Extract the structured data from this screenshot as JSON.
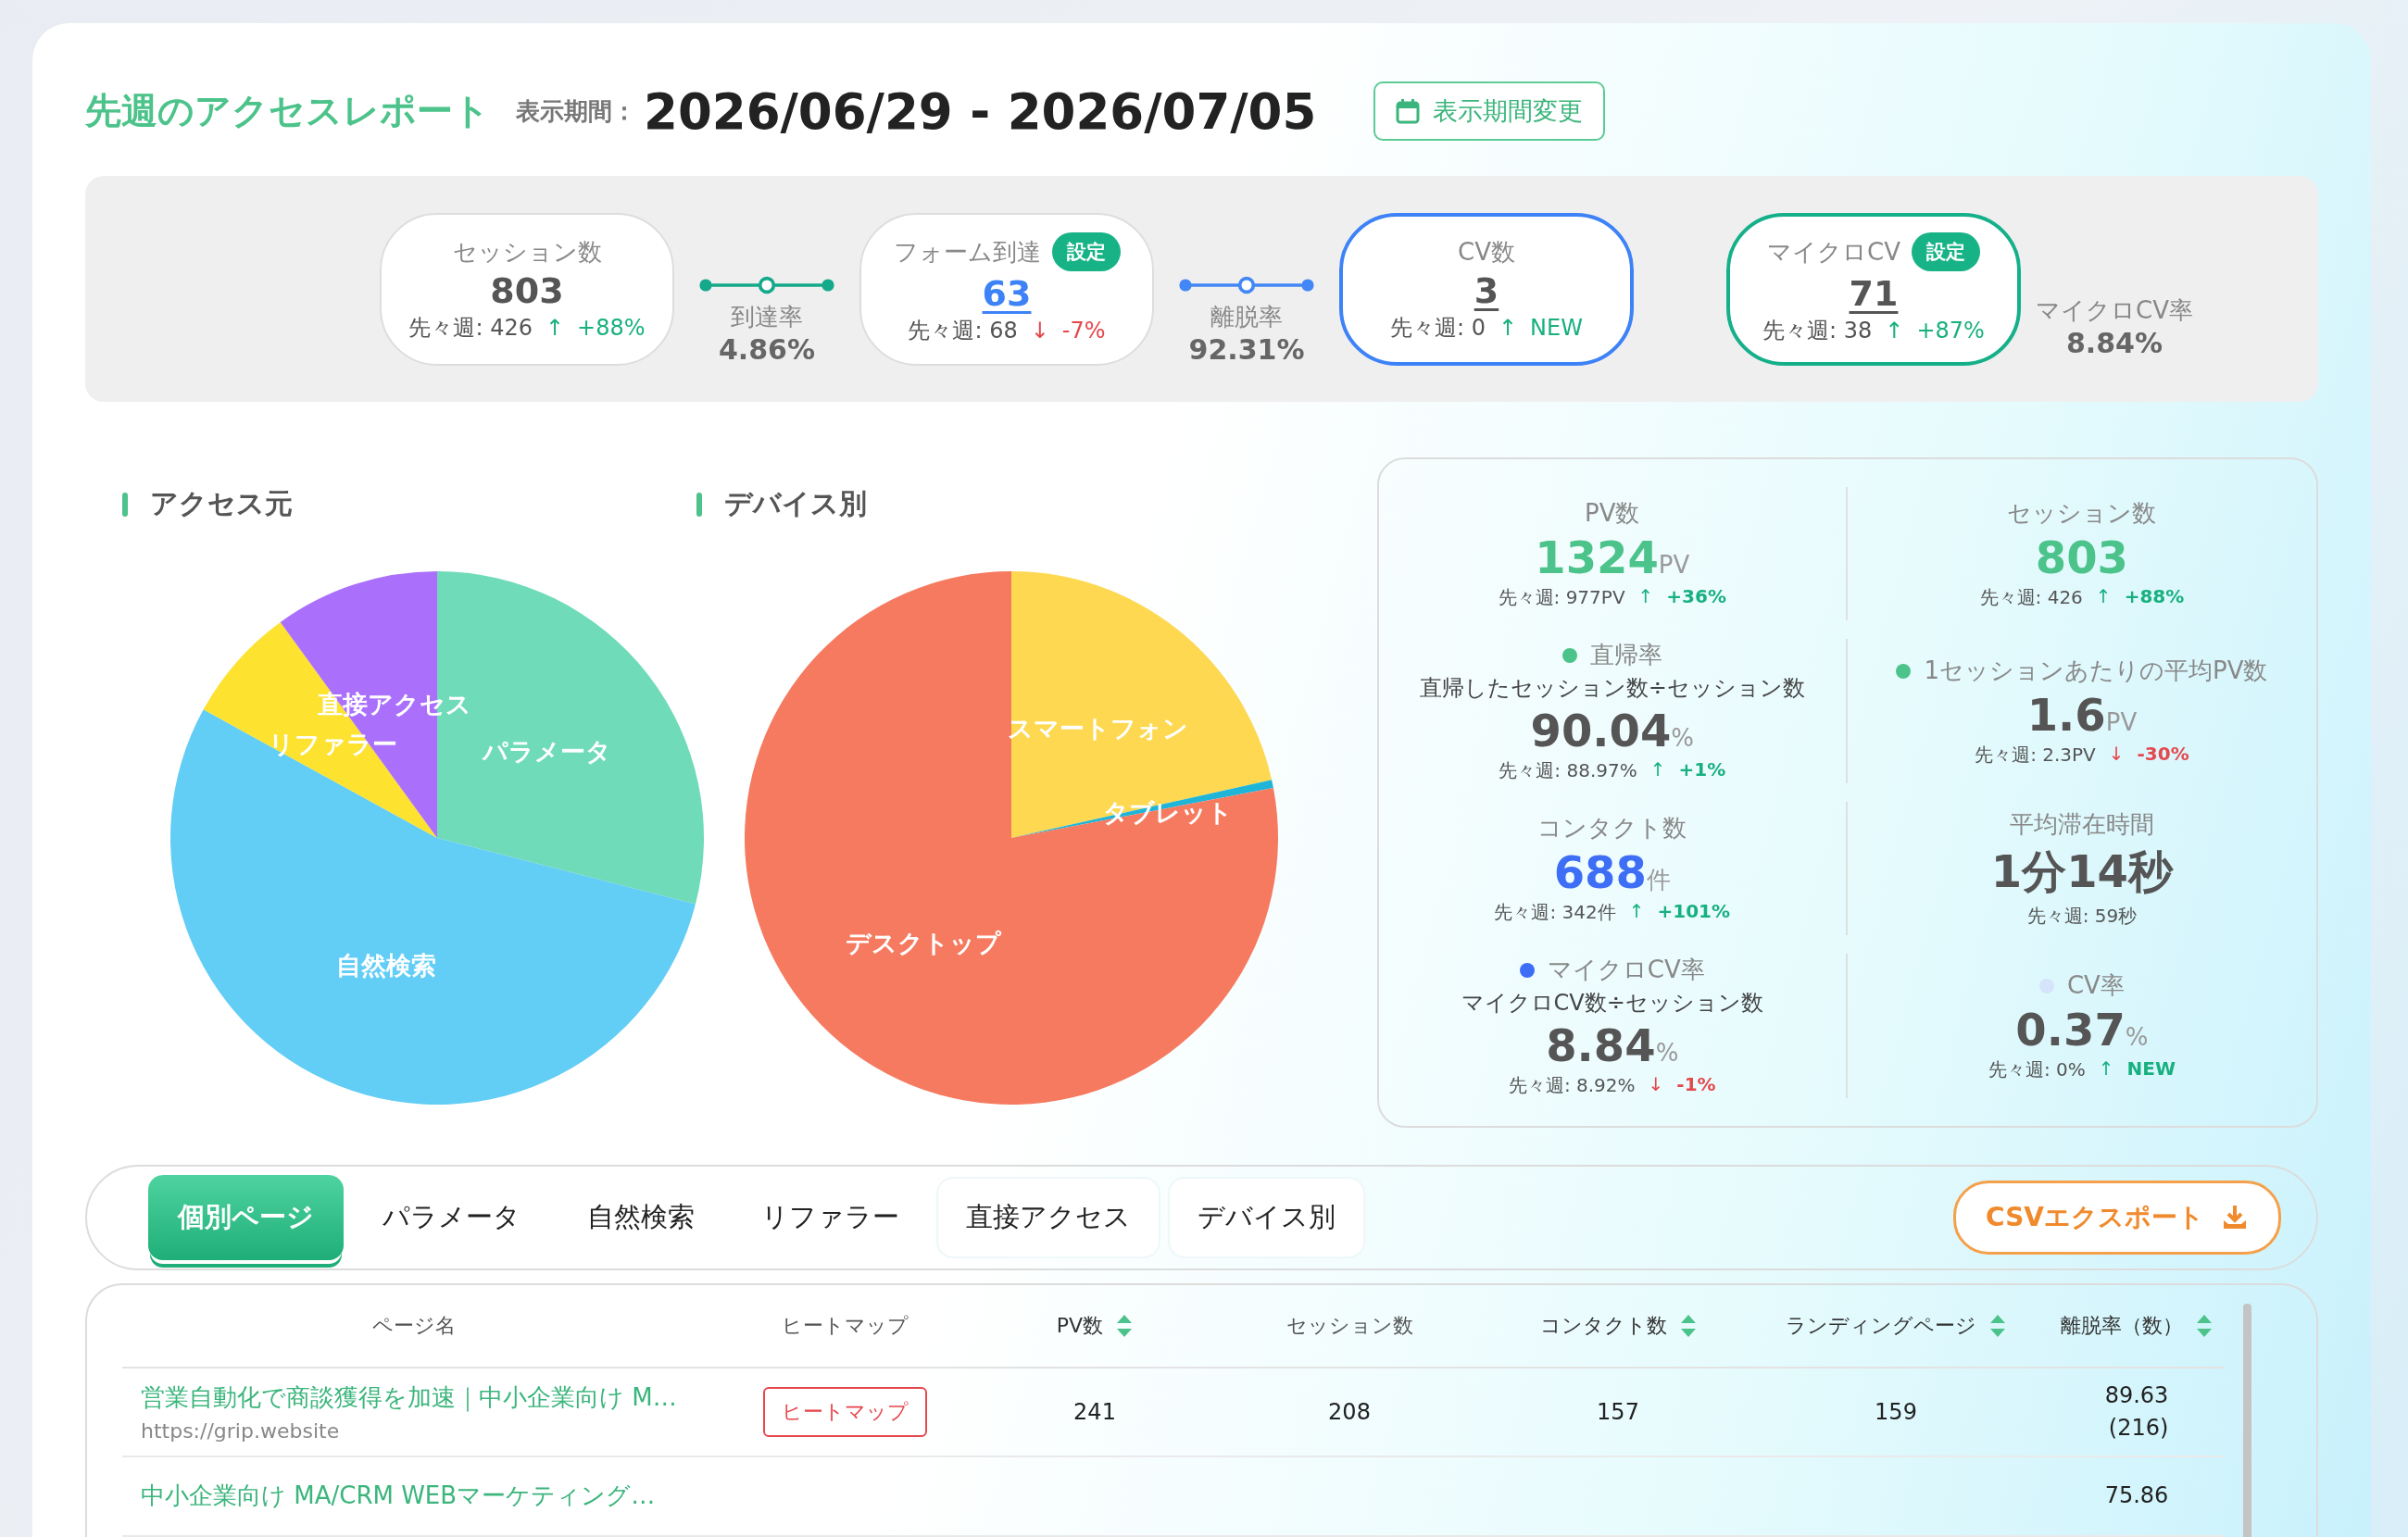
{
  "header": {
    "title": "先週のアクセスレポート",
    "period_label": "表示期間：",
    "period": "2026/06/29 - 2026/07/05",
    "change_button": "表示期間変更"
  },
  "funnel": [
    {
      "kind": "step",
      "label": "セッション数",
      "value": "803",
      "prev": "先々週: 426",
      "arrow": "↑",
      "change": "+88%",
      "rising": true
    },
    {
      "kind": "connector",
      "color": "#14a98a",
      "label": "到達率",
      "value": "4.86%"
    },
    {
      "kind": "form_step",
      "label": "フォーム到達",
      "badge": "設定",
      "value": "63",
      "prev": "先々週: 68",
      "arrow": "↓",
      "change": "-7%",
      "rising": false
    },
    {
      "kind": "connector",
      "color": "#4287f5",
      "label": "離脱率",
      "value": "92.31%"
    },
    {
      "kind": "cv_step",
      "label": "CV数",
      "value": "3",
      "prev": "先々週: 0",
      "arrow": "↑",
      "change": "NEW",
      "rising": true
    },
    {
      "kind": "micro_step",
      "label": "マイクロCV",
      "badge": "設定",
      "value": "71",
      "prev": "先々週: 38",
      "arrow": "↑",
      "change": "+87%",
      "rising": true
    },
    {
      "kind": "rate",
      "label": "マイクロCV率",
      "value": "8.84%"
    }
  ],
  "charts": [
    {
      "chart_data": {
        "type": "pie",
        "title": "アクセス元",
        "categories": [
          "パラメータ",
          "自然検索",
          "リファラー",
          "直接アクセス"
        ],
        "values": [
          29,
          54,
          7,
          10
        ],
        "colors": [
          "#6fdbb8",
          "#62cdf5",
          "#fde22f",
          "#aa70fc"
        ]
      }
    },
    {
      "chart_data": {
        "type": "pie",
        "title": "デバイス別",
        "categories": [
          "スマートフォン",
          "タブレット",
          "デスクトップ"
        ],
        "values": [
          21.5,
          0.5,
          78
        ],
        "colors": [
          "#fdd850",
          "#1fb5d8",
          "#f57a5f"
        ]
      }
    }
  ],
  "stats": [
    {
      "kind": "primary",
      "label": "PV数",
      "value": "1324",
      "unit": "PV",
      "prev": "先々週: 977PV",
      "arrow": "↑",
      "change": "+36%",
      "rising": true
    },
    {
      "kind": "primary",
      "label": "セッション数",
      "value": "803",
      "prev": "先々週: 426",
      "arrow": "↑",
      "change": "+88%",
      "rising": true
    },
    {
      "kind": "metric",
      "label": "直帰率",
      "color": "#4cc38a",
      "formula": "直帰したセッション数÷セッション数",
      "value": "90.04",
      "unit": "%",
      "prev": "先々週: 88.97%",
      "arrow": "↑",
      "change": "+1%",
      "rising": true
    },
    {
      "kind": "metric",
      "label": "1セッションあたりの平均PV数",
      "color": "#4cc38a",
      "value": "1.6",
      "unit": "PV",
      "prev": "先々週: 2.3PV",
      "arrow": "↓",
      "change": "-30%",
      "rising": false
    },
    {
      "kind": "contact",
      "label": "コンタクト数",
      "value": "688",
      "unit": "件",
      "prev": "先々週: 342件",
      "arrow": "↑",
      "change": "+101%",
      "rising": true
    },
    {
      "kind": "metric",
      "label": "平均滞在時間",
      "value": "1分14秒",
      "prev": "先々週: 59秒"
    },
    {
      "kind": "metric",
      "label": "マイクロCV率",
      "color": "#3d6ef5",
      "formula": "マイクロCV数÷セッション数",
      "value": "8.84",
      "unit": "%",
      "prev": "先々週: 8.92%",
      "arrow": "↓",
      "change": "-1%",
      "rising": false
    },
    {
      "kind": "metric",
      "label": "CV率",
      "color": "#d5e3fb",
      "value": "0.37",
      "unit": "%",
      "prev": "先々週: 0%",
      "arrow": "↑",
      "change": "NEW",
      "rising": true
    }
  ],
  "tabs": [
    {
      "label": "個別ページ",
      "selected": true,
      "shaded": false
    },
    {
      "label": "パラメータ",
      "selected": false,
      "shaded": false
    },
    {
      "label": "自然検索",
      "selected": false,
      "shaded": false
    },
    {
      "label": "リファラー",
      "selected": false,
      "shaded": false
    },
    {
      "label": "直接アクセス",
      "selected": false,
      "shaded": true
    },
    {
      "label": "デバイス別",
      "selected": false,
      "shaded": true
    }
  ],
  "export_button": "CSVエクスポート",
  "table": {
    "columns": [
      {
        "label": "ページ名",
        "sortable": false
      },
      {
        "label": "ヒートマップ",
        "sortable": false
      },
      {
        "label": "PV数",
        "sortable": true
      },
      {
        "label": "セッション数",
        "sortable": false
      },
      {
        "label": "コンタクト数",
        "sortable": true
      },
      {
        "label": "ランディングページ",
        "sortable": true
      },
      {
        "label": "離脱率（数）",
        "sortable": true
      }
    ],
    "rows": [
      {
        "title": "営業自動化で商談獲得を加速｜中小企業向け M…",
        "url": "https://grip.website",
        "heatmap": "ヒートマップ",
        "pv": "241",
        "sessions": "208",
        "contacts": "157",
        "landing": "159",
        "exit_rate": "89.63",
        "exit_count": "(216)"
      },
      {
        "title": "中小企業向け MA/CRM WEBマーケティング…",
        "exit_rate": "75.86"
      }
    ]
  }
}
